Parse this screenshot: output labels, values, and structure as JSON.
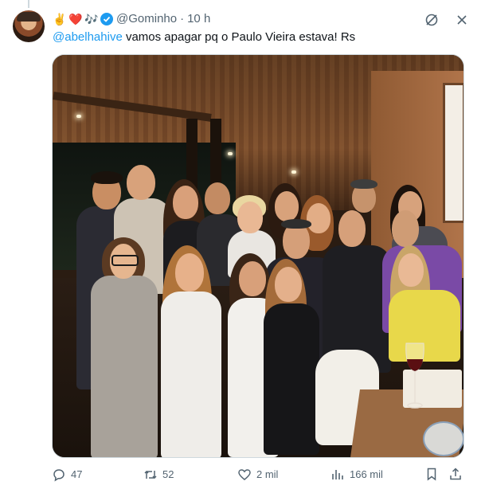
{
  "post": {
    "display_name_emojis": [
      "✌️",
      "❤️",
      "🎶"
    ],
    "handle": "@Gominho",
    "separator": "·",
    "time": "10 h",
    "mention": "@abelhahive",
    "text": " vamos apagar pq o Paulo Vieira estava! Rs"
  },
  "actions": {
    "replies": "47",
    "reposts": "52",
    "likes": "2 mil",
    "views": "166 mil"
  },
  "colors": {
    "accent": "#1d9bf0",
    "secondary_text": "#536471",
    "border": "#cfd9de"
  },
  "icons": [
    "grok-icon",
    "more-icon",
    "verified-badge-icon",
    "reply-icon",
    "repost-icon",
    "like-icon",
    "views-icon",
    "bookmark-icon",
    "share-icon"
  ]
}
